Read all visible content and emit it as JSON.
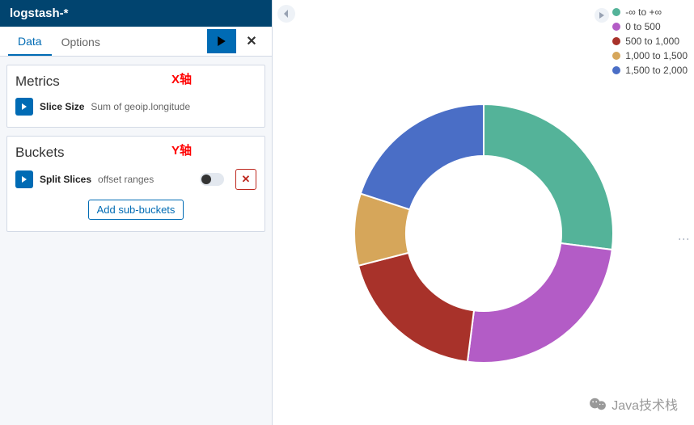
{
  "header": {
    "title": "logstash-*"
  },
  "tabs": {
    "data": "Data",
    "options": "Options"
  },
  "metrics": {
    "title": "Metrics",
    "axis_label": "X轴",
    "row_label": "Slice Size",
    "row_sub": "Sum of geoip.longitude"
  },
  "buckets": {
    "title": "Buckets",
    "axis_label": "Y轴",
    "row_label": "Split Slices",
    "row_sub": "offset ranges",
    "add_sub": "Add sub-buckets"
  },
  "legend": {
    "items": [
      {
        "label": "-∞ to +∞",
        "color": "#54b399"
      },
      {
        "label": "0 to 500",
        "color": "#b35cc6"
      },
      {
        "label": "500 to 1,000",
        "color": "#a8322a"
      },
      {
        "label": "1,000 to 1,500",
        "color": "#d6a65a"
      },
      {
        "label": "1,500 to 2,000",
        "color": "#4a6ec6"
      }
    ]
  },
  "watermark": "Java技术栈",
  "chart_data": {
    "type": "pie",
    "title": "",
    "inner_radius_pct": 60,
    "slices": [
      {
        "label": "-∞ to +∞",
        "value": 27,
        "color": "#54b399"
      },
      {
        "label": "0 to 500",
        "value": 25,
        "color": "#b35cc6"
      },
      {
        "label": "500 to 1,000",
        "value": 19,
        "color": "#a8322a"
      },
      {
        "label": "1,000 to 1,500",
        "value": 9,
        "color": "#d6a65a"
      },
      {
        "label": "1,500 to 2,000",
        "value": 20,
        "color": "#4a6ec6"
      }
    ]
  }
}
